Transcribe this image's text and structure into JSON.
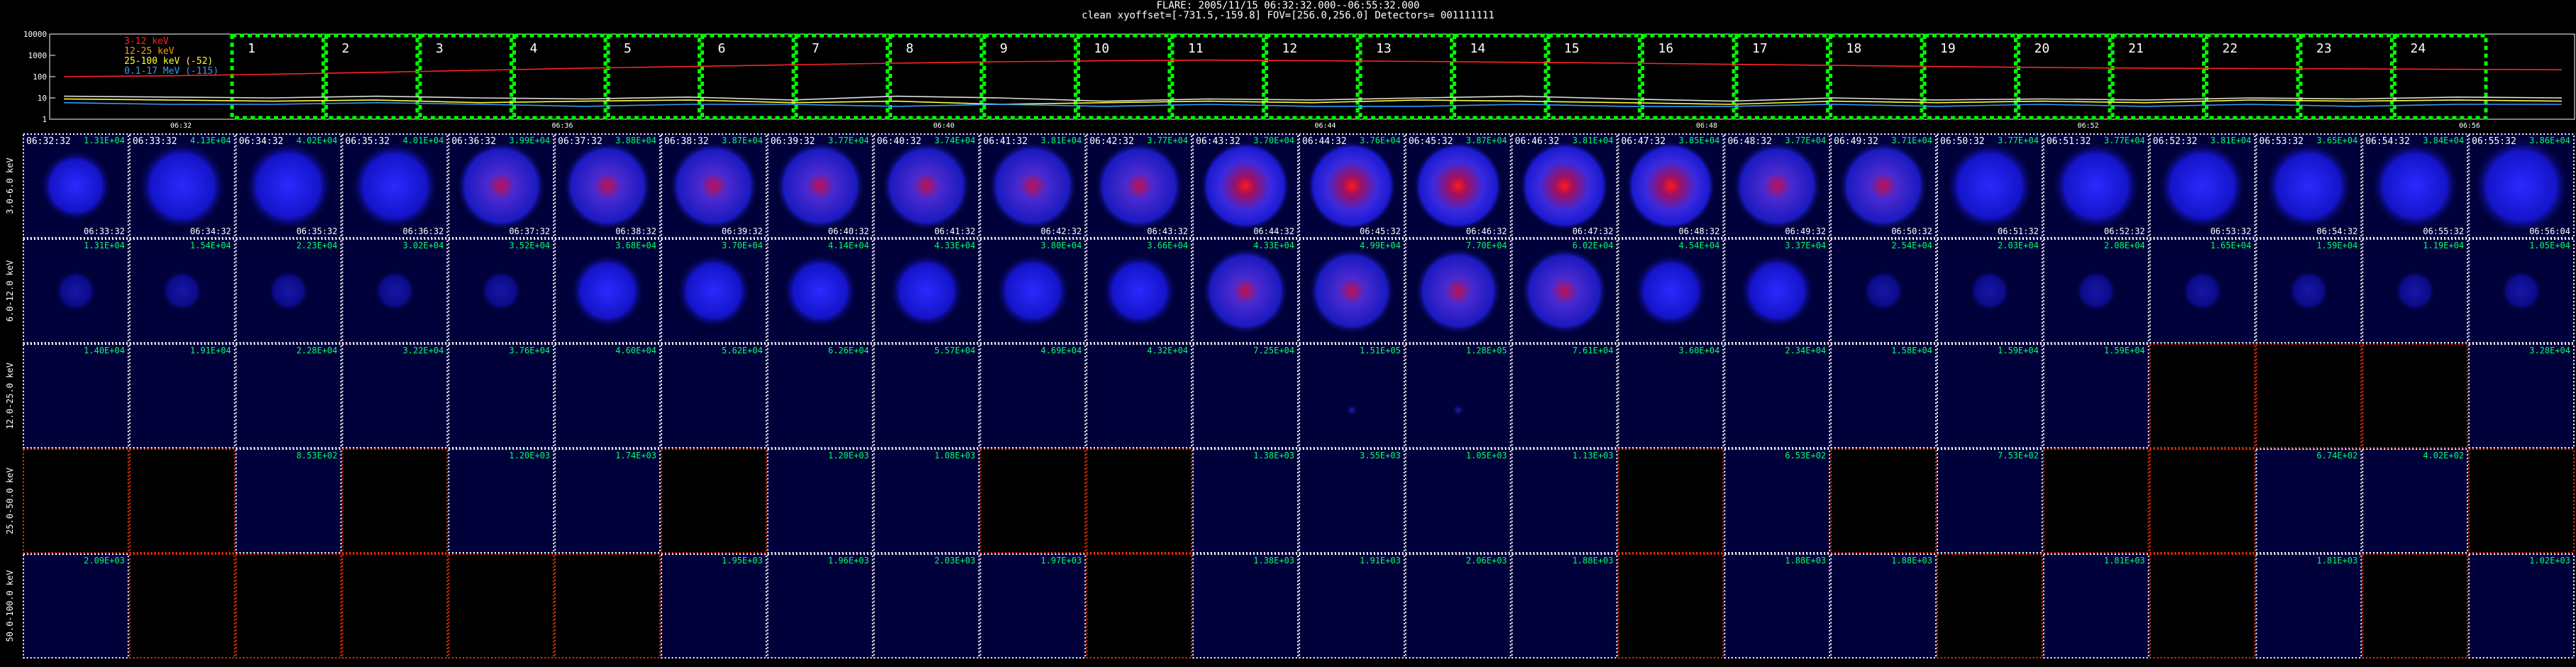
{
  "header": {
    "title": "FLARE: 2005/11/15 06:32:32.000--06:55:32.000",
    "subtitle": "clean    xyoffset=[-731.5,-159.8]    FOV=[256.0,256.0]      Detectors= 001111111"
  },
  "colors": {
    "background": "#000000",
    "grid_border": "#ffffff",
    "empty_border": "#ff3300",
    "box_dash": "#00ff00",
    "label_green": "#00ff66",
    "time_text": "#ffffff"
  },
  "chart_data": [
    {
      "type": "line",
      "log_y": true,
      "ylim": [
        1,
        10000
      ],
      "yticks": [
        "10000",
        "1000",
        "100",
        "10",
        "1"
      ],
      "xticks": [
        "06:32",
        "06:36",
        "06:40",
        "06:44",
        "06:48",
        "06:52",
        "06:56"
      ],
      "legend": [
        {
          "name": "3-12 keV",
          "color": "#ff2222"
        },
        {
          "name": "12-25 keV",
          "color": "#ff9900"
        },
        {
          "name": "25-100 keV (-52)",
          "color": "#ffff33"
        },
        {
          "name": "0.1-17 MeV (-115)",
          "color": "#3399ff"
        }
      ],
      "series": [
        {
          "name": "3-12 keV",
          "color": "#ff2222",
          "values": [
            100,
            110,
            130,
            160,
            200,
            250,
            300,
            360,
            430,
            500,
            560,
            600,
            560,
            520,
            470,
            430,
            380,
            340,
            300,
            270,
            250,
            240,
            230,
            220,
            210
          ]
        },
        {
          "name": "12-25 keV",
          "color": "#dddddd",
          "values": [
            12,
            11,
            10,
            12,
            10,
            9,
            11,
            8,
            12,
            10,
            7,
            9,
            8,
            10,
            12,
            9,
            7,
            10,
            8,
            9,
            8,
            10,
            9,
            11,
            10
          ]
        },
        {
          "name": "25-100 keV (-52)",
          "color": "#ffff33",
          "values": [
            9,
            8,
            7,
            8,
            6,
            7,
            8,
            6,
            7,
            5,
            6,
            7,
            6,
            8,
            7,
            6,
            5,
            7,
            6,
            7,
            6,
            8,
            7,
            8,
            7
          ]
        },
        {
          "name": "0.1-17 MeV (-115)",
          "color": "#3399ff",
          "values": [
            6,
            5,
            5,
            6,
            5,
            4,
            5,
            5,
            4,
            5,
            4,
            5,
            4,
            4,
            5,
            4,
            4,
            5,
            4,
            5,
            4,
            5,
            4,
            5,
            5
          ]
        }
      ],
      "intervals": [
        "1",
        "2",
        "3",
        "4",
        "5",
        "6",
        "7",
        "8",
        "9",
        "10",
        "11",
        "12",
        "13",
        "14",
        "15",
        "16",
        "17",
        "18",
        "19",
        "20",
        "21",
        "22",
        "23",
        "24"
      ]
    },
    {
      "type": "heatmap",
      "energy_bands": [
        "3.0-6.0 keV",
        "6.0-12.0 keV",
        "12.0-25.0 keV",
        "25.0-50.0 keV",
        "50.0-100.0 keV"
      ],
      "start_times": [
        "06:32:32",
        "06:33:32",
        "06:34:32",
        "06:35:32",
        "06:36:32",
        "06:37:32",
        "06:38:32",
        "06:39:32",
        "06:40:32",
        "06:41:32",
        "06:42:32",
        "06:43:32",
        "06:44:32",
        "06:45:32",
        "06:46:32",
        "06:47:32",
        "06:48:32",
        "06:49:32",
        "06:50:32",
        "06:51:32",
        "06:52:32",
        "06:53:32",
        "06:54:32",
        "06:55:32"
      ],
      "end_times": [
        "06:33:32",
        "06:34:32",
        "06:35:32",
        "06:36:32",
        "06:37:32",
        "06:38:32",
        "06:39:32",
        "06:40:32",
        "06:41:32",
        "06:42:32",
        "06:43:32",
        "06:44:32",
        "06:45:32",
        "06:46:32",
        "06:47:32",
        "06:48:32",
        "06:49:32",
        "06:50:32",
        "06:51:32",
        "06:52:32",
        "06:53:32",
        "06:54:32",
        "06:55:32",
        "06:56:04"
      ],
      "peaks": [
        [
          "1.31E+04",
          "4.13E+04",
          "4.02E+04",
          "4.01E+04",
          "3.99E+04",
          "3.88E+04",
          "3.87E+04",
          "3.77E+04",
          "3.74E+04",
          "3.81E+04",
          "3.77E+04",
          "3.70E+04",
          "3.76E+04",
          "3.87E+04",
          "3.81E+04",
          "3.85E+04",
          "3.77E+04",
          "3.71E+04",
          "3.77E+04",
          "3.77E+04",
          "3.81E+04",
          "3.65E+04",
          "3.84E+04",
          "3.86E+04"
        ],
        [
          "1.31E+04",
          "1.54E+04",
          "2.23E+04",
          "3.02E+04",
          "3.52E+04",
          "3.68E+04",
          "3.70E+04",
          "4.14E+04",
          "4.33E+04",
          "3.80E+04",
          "3.66E+04",
          "4.33E+04",
          "4.99E+04",
          "7.70E+04",
          "6.02E+04",
          "4.54E+04",
          "3.37E+04",
          "2.54E+04",
          "2.03E+04",
          "2.08E+04",
          "1.65E+04",
          "1.59E+04",
          "1.19E+04",
          "1.05E+04"
        ],
        [
          "1.40E+04",
          "1.91E+04",
          "2.28E+04",
          "3.22E+04",
          "3.76E+04",
          "4.60E+04",
          "5.62E+04",
          "6.26E+04",
          "5.57E+04",
          "4.69E+04",
          "4.32E+04",
          "7.25E+04",
          "1.51E+05",
          "1.28E+05",
          "7.61E+04",
          "3.60E+04",
          "2.34E+04",
          "1.58E+04",
          "1.59E+04",
          "1.59E+04",
          "",
          "",
          "",
          "3.28E+04"
        ],
        [
          "",
          "",
          "8.53E+02",
          "",
          "1.20E+03",
          "1.74E+03",
          "",
          "1.20E+03",
          "1.08E+03",
          "",
          "",
          "1.38E+03",
          "3.55E+03",
          "1.05E+03",
          "1.13E+03",
          "",
          "6.53E+02",
          "",
          "7.53E+02",
          "",
          "",
          "6.74E+02",
          "4.02E+02",
          ""
        ],
        [
          "2.09E+03",
          "",
          "",
          "",
          "",
          "",
          "1.95E+03",
          "1.96E+03",
          "2.03E+03",
          "1.97E+03",
          "",
          "1.38E+03",
          "1.91E+03",
          "2.06E+03",
          "1.88E+03",
          "",
          "1.88E+03",
          "1.88E+03",
          "",
          "1.81E+03",
          "",
          "1.81E+03",
          "",
          "1.02E+03"
        ]
      ]
    }
  ]
}
